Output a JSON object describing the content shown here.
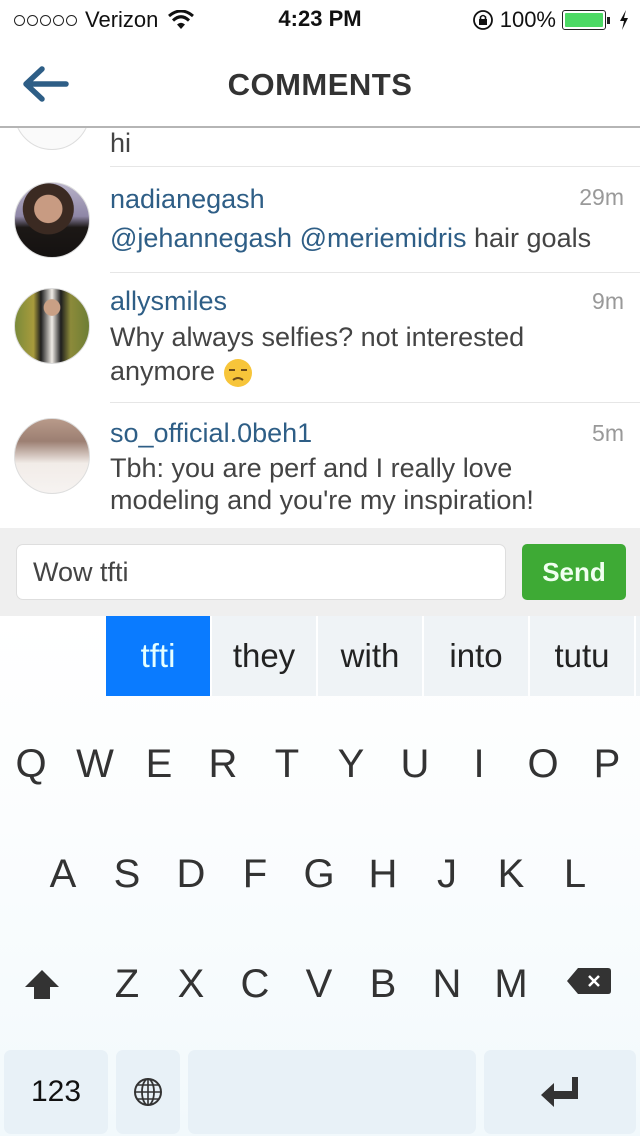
{
  "status_bar": {
    "carrier": "Verizon",
    "time": "4:23 PM",
    "battery": "100%",
    "battery_level": 1.0,
    "battery_color": "#4cd964"
  },
  "nav": {
    "title": "COMMENTS",
    "back_icon": "arrow-left-icon",
    "accent": "#2e5e86"
  },
  "comments": [
    {
      "username": "",
      "time": "",
      "text": "hi",
      "partial": true
    },
    {
      "username": "nadianegash",
      "time": "29m",
      "mentions": [
        "@jehannegash",
        "@meriemidris"
      ],
      "text": "hair goals"
    },
    {
      "username": "allysmiles",
      "time": "9m",
      "text_line1": "Why always selfies? not interested",
      "text_line2": "anymore",
      "emoji": "unamused-face-emoji"
    },
    {
      "username": "so_official.0beh1",
      "time": "5m",
      "text_line1": "Tbh: you are perf and I really love",
      "text_line2": "modeling and you're my inspiration!"
    }
  ],
  "composer": {
    "value": "Wow tfti",
    "send_label": "Send",
    "send_color": "#3eaa35"
  },
  "keyboard": {
    "suggestions": [
      "tfti",
      "they",
      "with",
      "into",
      "tutu"
    ],
    "active_suggestion": 0,
    "row1": [
      "Q",
      "W",
      "E",
      "R",
      "T",
      "Y",
      "U",
      "I",
      "O",
      "P"
    ],
    "row2": [
      "A",
      "S",
      "D",
      "F",
      "G",
      "H",
      "J",
      "K",
      "L"
    ],
    "row3": [
      "Z",
      "X",
      "C",
      "V",
      "B",
      "N",
      "M"
    ],
    "numbers_label": "123",
    "shift_icon": "shift-arrow-icon",
    "delete_icon": "backspace-icon",
    "globe_icon": "globe-icon",
    "return_icon": "return-icon"
  }
}
